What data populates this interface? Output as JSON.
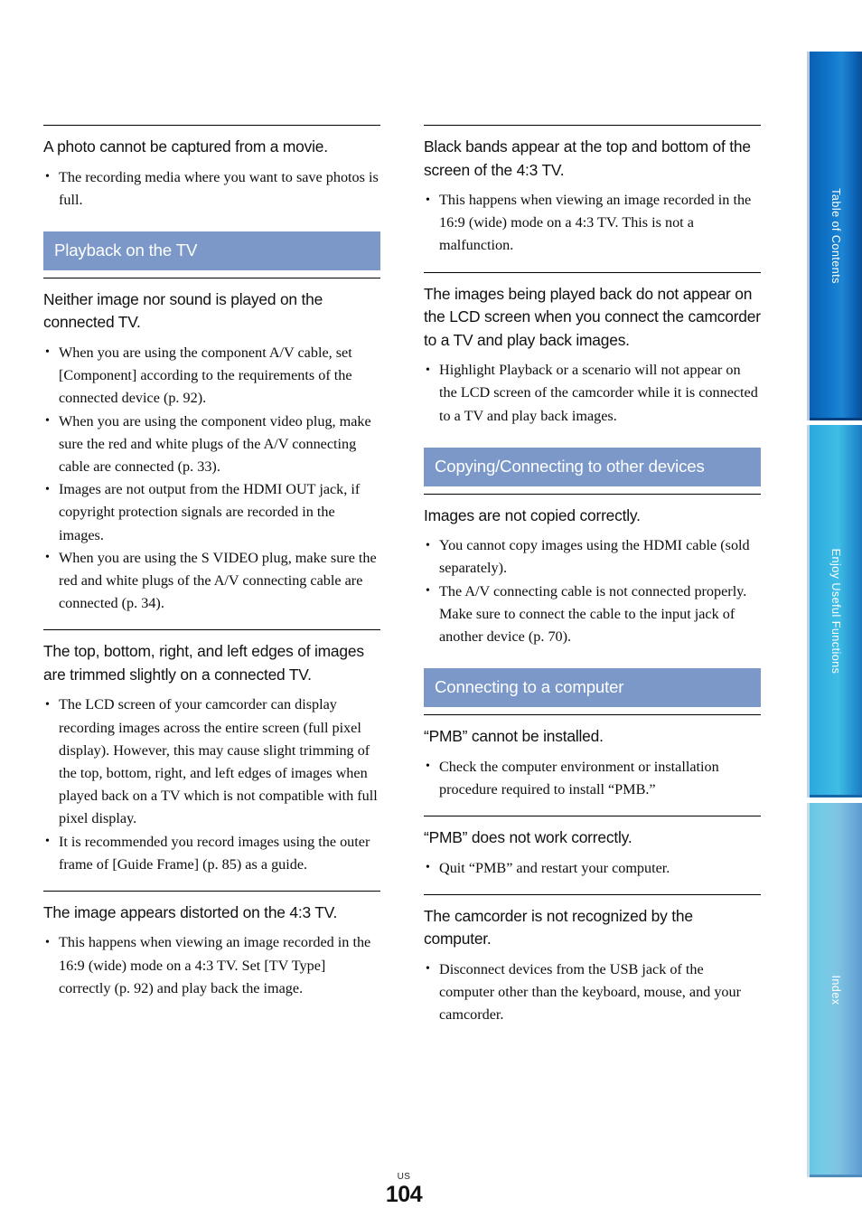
{
  "page": {
    "number": "104",
    "region_code": "US"
  },
  "sidebar": {
    "tabs": [
      {
        "label": "Table of Contents",
        "color": "#0f74c8"
      },
      {
        "label": "Enjoy Useful Functions",
        "color": "#35b4e2"
      },
      {
        "label": "Index",
        "color": "#75cbe6"
      }
    ]
  },
  "theme": {
    "section_bar_color": "#7b98c9",
    "section_bar_text": "#ffffff",
    "rule_color": "#000000"
  },
  "left_column": {
    "blocks": [
      {
        "type": "qa",
        "heading": "A photo cannot be captured from a movie.",
        "bullets": [
          "The recording media where you want to save photos is full."
        ]
      },
      {
        "type": "section",
        "title": "Playback on the TV"
      },
      {
        "type": "qa",
        "heading": "Neither image nor sound is played on the connected TV.",
        "bullets": [
          "When you are using the component A/V cable, set [Component] according to the requirements of the connected device (p. 92).",
          "When you are using the component video plug, make sure the red and white plugs of the A/V connecting cable are connected (p. 33).",
          "Images are not output from the HDMI OUT jack, if copyright protection signals are recorded in the images.",
          "When you are using the S VIDEO plug, make sure the red and white plugs of the A/V connecting cable are connected (p. 34)."
        ]
      },
      {
        "type": "qa",
        "heading": "The top, bottom, right, and left edges of images are trimmed slightly on a connected TV.",
        "bullets": [
          "The LCD screen of your camcorder can display recording images across the entire screen (full pixel display). However, this may cause slight trimming of the top, bottom, right, and left edges of images when played back on a TV which is not compatible with full pixel display.",
          "It is recommended you record images using the outer frame of [Guide Frame] (p. 85) as a guide."
        ]
      },
      {
        "type": "qa",
        "heading": "The image appears distorted on the 4:3 TV.",
        "bullets": [
          "This happens when viewing an image recorded in the 16:9 (wide) mode on a 4:3 TV. Set [TV Type] correctly (p. 92) and play back the image."
        ]
      }
    ]
  },
  "right_column": {
    "blocks": [
      {
        "type": "qa",
        "heading": "Black bands appear at the top and bottom of the screen of the 4:3 TV.",
        "bullets": [
          "This happens when viewing an image recorded in the 16:9 (wide) mode on a 4:3 TV. This is not a malfunction."
        ]
      },
      {
        "type": "qa",
        "heading": "The images being played back do not appear on the LCD screen when you connect the camcorder to a TV and play back images.",
        "bullets": [
          "Highlight Playback or a scenario will not appear on the LCD screen of the camcorder while it is connected to a TV and play back images."
        ]
      },
      {
        "type": "section",
        "title": "Copying/Connecting to other devices"
      },
      {
        "type": "qa",
        "heading": "Images are not copied correctly.",
        "bullets": [
          "You cannot copy images using the HDMI cable (sold separately).",
          "The A/V connecting cable is not connected properly. Make sure to connect the cable to the input jack of another device (p. 70)."
        ]
      },
      {
        "type": "section",
        "title": "Connecting to a computer"
      },
      {
        "type": "qa",
        "heading": "“PMB” cannot be installed.",
        "bullets": [
          "Check the computer environment or installation procedure required to install “PMB.”"
        ]
      },
      {
        "type": "qa",
        "heading": "“PMB” does not work correctly.",
        "bullets": [
          "Quit “PMB” and restart your computer."
        ]
      },
      {
        "type": "qa",
        "heading": "The camcorder is not recognized by the computer.",
        "bullets": [
          "Disconnect devices from the USB jack of the computer other than the keyboard, mouse, and your camcorder."
        ]
      }
    ]
  }
}
